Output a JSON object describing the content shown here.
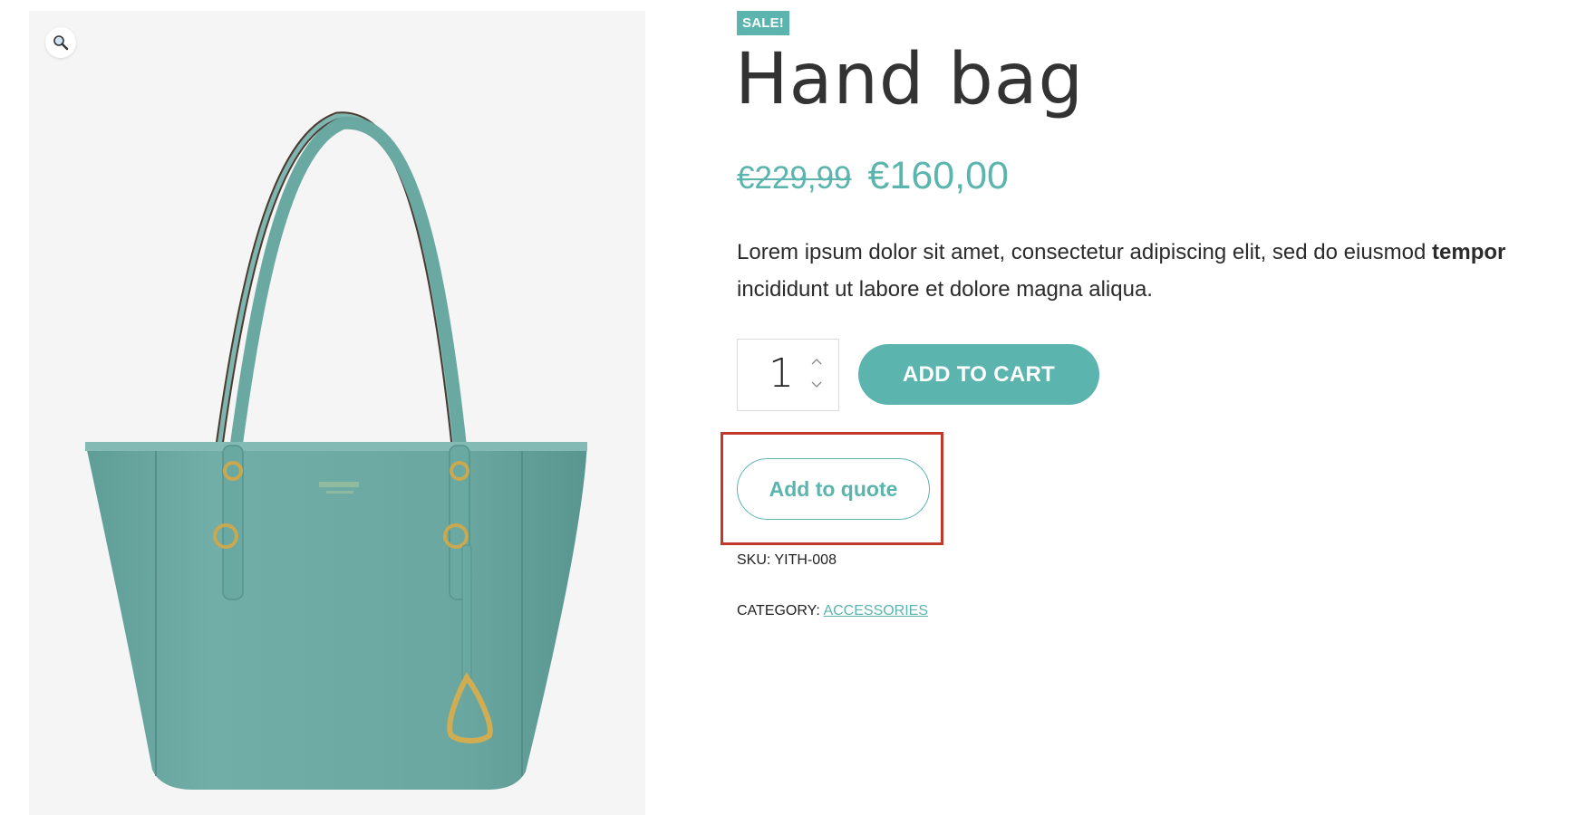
{
  "gallery": {
    "zoom_icon": "magnifier-icon",
    "image_alt": "Hand bag product photo"
  },
  "product": {
    "badge": "SALE!",
    "title": "Hand bag",
    "price_old": "€229,99",
    "price_new": "€160,00",
    "description_before": "Lorem ipsum dolor sit amet, consectetur adipiscing elit, sed do eiusmod ",
    "description_bold": "tempor",
    "description_after": " incididunt ut labore et dolore magna aliqua.",
    "quantity": "1",
    "add_to_cart_label": "ADD TO CART",
    "add_to_quote_label": "Add to quote",
    "sku_label": "SKU:",
    "sku_value": "YITH-008",
    "category_label": "CATEGORY:",
    "category_value": "ACCESSORIES"
  },
  "colors": {
    "accent": "#5bb4ad",
    "highlight_border": "#c0392b",
    "bag": "#6aa8a2"
  }
}
